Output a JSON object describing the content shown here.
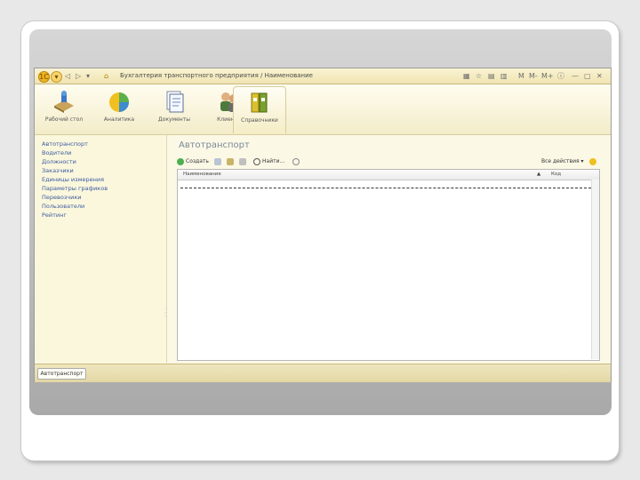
{
  "window": {
    "title": "Бухгалтерия транспортного предприятия / Наименование",
    "toolbar_icons": [
      "app-menu-icon",
      "back-arrow-icon",
      "forward-arrow-icon",
      "home-icon",
      "favorites-icon",
      "history-icon",
      "calculator-icon",
      "calendar-icon",
      "memory-icons",
      "info-icon",
      "minimize-icon",
      "maximize-icon",
      "close-icon"
    ]
  },
  "ribbon": {
    "sections": [
      {
        "label": "Рабочий стол",
        "icon": "desktop-icon"
      },
      {
        "label": "Аналитика",
        "icon": "pie-chart-icon"
      },
      {
        "label": "Документы",
        "icon": "documents-icon"
      },
      {
        "label": "Клиенты",
        "icon": "people-icon"
      },
      {
        "label": "Справочники",
        "icon": "binders-icon",
        "active": true
      }
    ]
  },
  "nav": {
    "items": [
      "Автотранспорт",
      "Водители",
      "Должности",
      "Заказчики",
      "Единицы измерения",
      "Параметры графиков",
      "Перевозчики",
      "Пользователи",
      "Рейтинг"
    ]
  },
  "form": {
    "title": "Автотранспорт",
    "commands": {
      "create": "Создать",
      "find": "Найти...",
      "more": "Все действия"
    },
    "columns": [
      "Наименование",
      "Код"
    ]
  },
  "bottom": {
    "tab": "Автотранспорт"
  },
  "colors": {
    "accent": "#f0a000",
    "title_text": "#7a8a99",
    "nav_link": "#3b5ca0"
  }
}
